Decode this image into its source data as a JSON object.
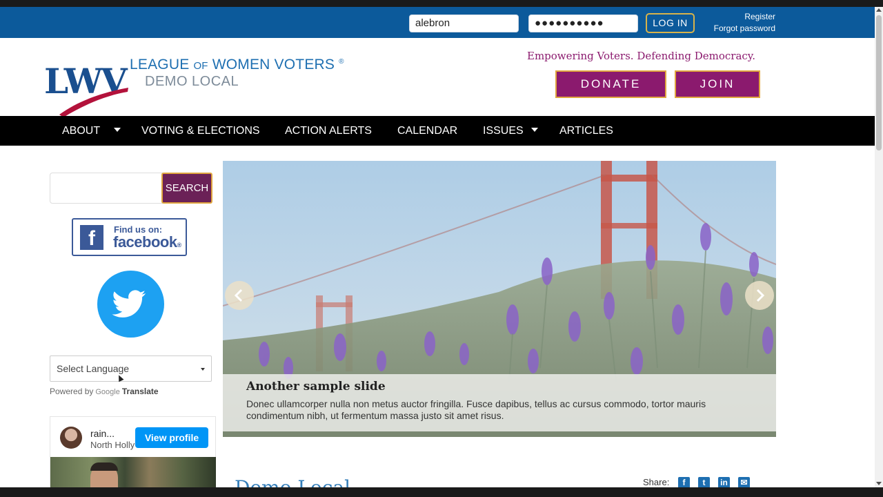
{
  "topbar": {
    "username_value": "alebron",
    "password_value": "●●●●●●●●●●",
    "login_label": "LOG IN",
    "register_label": "Register",
    "forgot_label": "Forgot password"
  },
  "header": {
    "logo_text": "LWV",
    "org_name_part1": "LEAGUE ",
    "org_name_of": "OF",
    "org_name_part2": " WOMEN VOTERS",
    "org_reg_mark": "®",
    "org_sub": "DEMO LOCAL",
    "tagline": "Empowering Voters. Defending Democracy.",
    "donate_label": "DONATE",
    "join_label": "JOIN"
  },
  "nav": {
    "items": [
      {
        "label": "ABOUT"
      },
      {
        "label": "VOTING & ELECTIONS"
      },
      {
        "label": "ACTION ALERTS"
      },
      {
        "label": "CALENDAR"
      },
      {
        "label": "ISSUES"
      },
      {
        "label": "ARTICLES"
      }
    ]
  },
  "sidebar": {
    "search_value": "",
    "search_button": "SEARCH",
    "facebook_find": "Find us on:",
    "facebook_word": "facebook",
    "facebook_mark": "®",
    "language_selected": "Select Language",
    "powered_by": "Powered by",
    "google": "Google",
    "translate": "Translate",
    "instagram": {
      "name": "rain...",
      "location": "North Holly",
      "view_profile": "View profile"
    }
  },
  "slider": {
    "title": "Another sample slide",
    "text": "Donec ullamcorper nulla non metus auctor fringilla. Fusce dapibus, tellus ac cursus commodo, tortor mauris condimentum nibh, ut fermentum massa justo sit amet risus."
  },
  "main": {
    "heading": "Demo Local",
    "share_label": "Share:"
  },
  "colors": {
    "topbar_blue": "#0c5a9b",
    "brand_purple": "#8b1a6e",
    "gold_border": "#e0a63e",
    "twitter_blue": "#1da1f2",
    "facebook_blue": "#3b5998"
  }
}
